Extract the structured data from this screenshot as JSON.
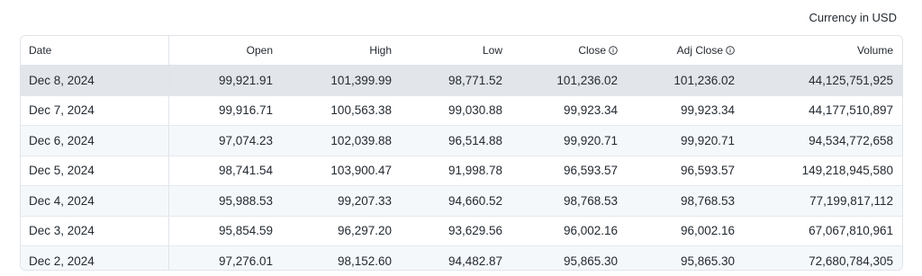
{
  "currency_label": "Currency in USD",
  "columns": {
    "date": "Date",
    "open": "Open",
    "high": "High",
    "low": "Low",
    "close": "Close",
    "adj_close": "Adj Close",
    "volume": "Volume"
  },
  "icons": {
    "close_info": "info-icon",
    "adj_close_info": "info-icon"
  },
  "rows": [
    {
      "date": "Dec 8, 2024",
      "open": "99,921.91",
      "high": "101,399.99",
      "low": "98,771.52",
      "close": "101,236.02",
      "adj_close": "101,236.02",
      "volume": "44,125,751,925"
    },
    {
      "date": "Dec 7, 2024",
      "open": "99,916.71",
      "high": "100,563.38",
      "low": "99,030.88",
      "close": "99,923.34",
      "adj_close": "99,923.34",
      "volume": "44,177,510,897"
    },
    {
      "date": "Dec 6, 2024",
      "open": "97,074.23",
      "high": "102,039.88",
      "low": "96,514.88",
      "close": "99,920.71",
      "adj_close": "99,920.71",
      "volume": "94,534,772,658"
    },
    {
      "date": "Dec 5, 2024",
      "open": "98,741.54",
      "high": "103,900.47",
      "low": "91,998.78",
      "close": "96,593.57",
      "adj_close": "96,593.57",
      "volume": "149,218,945,580"
    },
    {
      "date": "Dec 4, 2024",
      "open": "95,988.53",
      "high": "99,207.33",
      "low": "94,660.52",
      "close": "98,768.53",
      "adj_close": "98,768.53",
      "volume": "77,199,817,112"
    },
    {
      "date": "Dec 3, 2024",
      "open": "95,854.59",
      "high": "96,297.20",
      "low": "93,629.56",
      "close": "96,002.16",
      "adj_close": "96,002.16",
      "volume": "67,067,810,961"
    },
    {
      "date": "Dec 2, 2024",
      "open": "97,276.01",
      "high": "98,152.60",
      "low": "94,482.87",
      "close": "95,865.30",
      "adj_close": "95,865.30",
      "volume": "72,680,784,305"
    }
  ]
}
